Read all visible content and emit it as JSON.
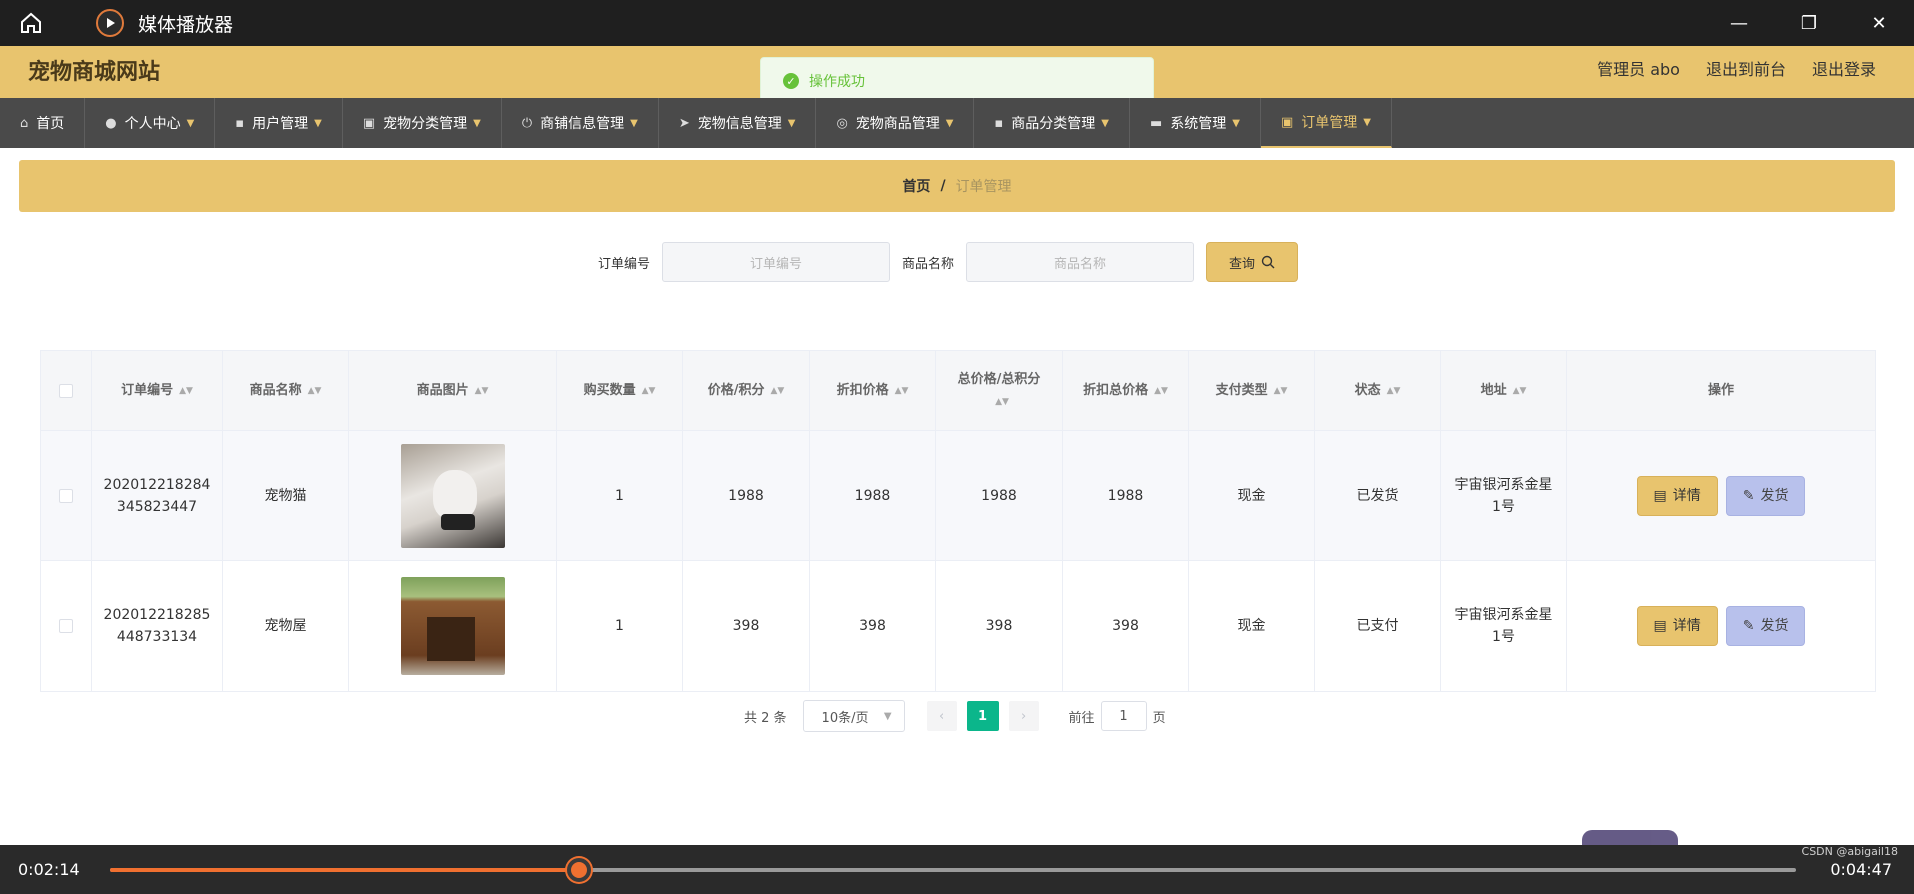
{
  "player": {
    "title": "媒体播放器",
    "time_current": "0:02:14",
    "time_total": "0:04:47",
    "progress_fraction": 0.278,
    "watermark": "CSDN @abigail18"
  },
  "site": {
    "title": "宠物商城网站",
    "admin_label": "管理员 abo",
    "to_front": "退出到前台",
    "logout": "退出登录"
  },
  "toast": {
    "message": "操作成功"
  },
  "nav": [
    {
      "label": "首页",
      "icon": "home-icon"
    },
    {
      "label": "个人中心",
      "icon": "user-icon"
    },
    {
      "label": "用户管理",
      "icon": "briefcase-icon"
    },
    {
      "label": "宠物分类管理",
      "icon": "clipboard-icon"
    },
    {
      "label": "商铺信息管理",
      "icon": "power-icon"
    },
    {
      "label": "宠物信息管理",
      "icon": "send-icon"
    },
    {
      "label": "宠物商品管理",
      "icon": "circle-icon"
    },
    {
      "label": "商品分类管理",
      "icon": "briefcase-icon"
    },
    {
      "label": "系统管理",
      "icon": "monitor-icon"
    },
    {
      "label": "订单管理",
      "icon": "clipboard-check-icon"
    }
  ],
  "breadcrumb": {
    "home": "首页",
    "sep": "/",
    "current": "订单管理"
  },
  "search": {
    "order_label": "订单编号",
    "order_placeholder": "订单编号",
    "product_label": "商品名称",
    "product_placeholder": "商品名称",
    "query_label": "查询"
  },
  "table": {
    "headers": [
      "订单编号",
      "商品名称",
      "商品图片",
      "购买数量",
      "价格/积分",
      "折扣价格",
      "总价格/总积分",
      "折扣总价格",
      "支付类型",
      "状态",
      "地址",
      "操作"
    ],
    "rows": [
      {
        "order_no": "202012218284345823447",
        "order_no_l1": "202012218284",
        "order_no_l2": "345823447",
        "name": "宠物猫",
        "qty": "1",
        "price": "1988",
        "discount": "1988",
        "total": "1988",
        "discount_total": "1988",
        "pay": "现金",
        "status": "已发货",
        "addr_l1": "宇宙银河系金星",
        "addr_l2": "1号"
      },
      {
        "order_no": "202012218285448733134",
        "order_no_l1": "202012218285",
        "order_no_l2": "448733134",
        "name": "宠物屋",
        "qty": "1",
        "price": "398",
        "discount": "398",
        "total": "398",
        "discount_total": "398",
        "pay": "现金",
        "status": "已支付",
        "addr_l1": "宇宙银河系金星",
        "addr_l2": "1号"
      }
    ],
    "detail_label": "详情",
    "ship_label": "发货"
  },
  "pager": {
    "total": "共 2 条",
    "page_size": "10条/页",
    "current_page": "1",
    "goto_label": "前往",
    "goto_value": "1",
    "page_unit": "页"
  },
  "colors": {
    "accent": "#e8c46e",
    "nav_bg": "#4a4a4a",
    "page_active": "#0bb68b",
    "progress": "#f07030"
  }
}
